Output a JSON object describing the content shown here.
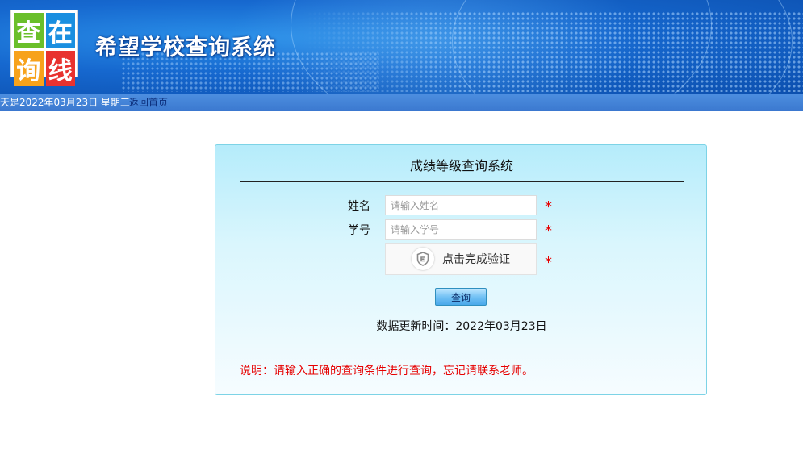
{
  "header": {
    "logo_chars": [
      "查",
      "在",
      "询",
      "线"
    ],
    "title": "希望学校查询系统"
  },
  "infobar": {
    "date_text": "天是2022年03月23日  星期三",
    "home_link": "返回首页"
  },
  "panel": {
    "title": "成绩等级查询系统",
    "name_label": "姓名",
    "name_placeholder": "请输入姓名",
    "name_value": "",
    "id_label": "学号",
    "id_placeholder": "请输入学号",
    "id_value": "",
    "required_mark": "*",
    "captcha_text": "点击完成验证",
    "captcha_icon": "shield-check-icon",
    "query_button": "查询",
    "update_text": "数据更新时间：2022年03月23日",
    "note": "说明：请输入正确的查询条件进行查询，忘记请联系老师。"
  },
  "colors": {
    "banner_blue": "#1668cf",
    "infobar_blue": "#3b78cf",
    "panel_border": "#7dd3e6",
    "required_red": "#e60000",
    "logo_green": "#6abf2a",
    "logo_blue": "#1a8fe0",
    "logo_orange": "#f7a21b",
    "logo_red": "#e8322f"
  }
}
